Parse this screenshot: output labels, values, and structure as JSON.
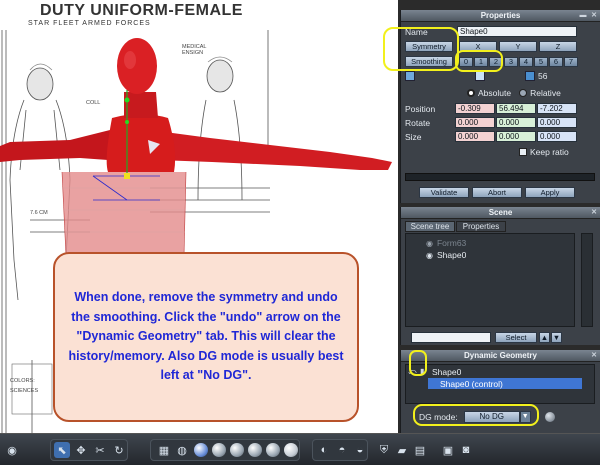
{
  "reference": {
    "title": "DUTY UNIFORM-FEMALE",
    "subtitle": "STAR FLEET ARMED FORCES",
    "labels": [
      "MEDICAL ENSIGN",
      "COLL",
      "7.6 CM",
      "COLORS:",
      "SCIENCES"
    ]
  },
  "callout": {
    "text": "When done, remove the symmetry and undo the smoothing. Click the \"undo\" arrow on the \"Dynamic Geometry\" tab. This will clear the history/memory. Also DG mode is usually best left at \"No DG\"."
  },
  "properties": {
    "title": "Properties",
    "name_label": "Name",
    "name_value": "Shape0",
    "symmetry_label": "Symmetry",
    "axes": [
      "X",
      "Y",
      "Z"
    ],
    "smoothing_label": "Smoothing",
    "smoothing_levels": [
      "0",
      "1",
      "2",
      "3",
      "4",
      "5",
      "6",
      "7"
    ],
    "polycount": "56",
    "absolute_label": "Absolute",
    "relative_label": "Relative",
    "position_label": "Position",
    "rotate_label": "Rotate",
    "size_label": "Size",
    "position": [
      "-0.309",
      "56.494",
      "-7.202"
    ],
    "rotate": [
      "0.000",
      "0.000",
      "0.000"
    ],
    "size": [
      "0.000",
      "0.000",
      "0.000"
    ],
    "keep_ratio_label": "Keep ratio",
    "validate_label": "Validate",
    "abort_label": "Abort",
    "apply_label": "Apply"
  },
  "scene": {
    "title": "Scene",
    "tabs": [
      "Scene tree",
      "Properties"
    ],
    "items": [
      "Form63",
      "Shape0"
    ],
    "select_label": "Select"
  },
  "dynamic_geometry": {
    "title": "Dynamic Geometry",
    "items": [
      "Shape0",
      "Shape0 (control)"
    ],
    "dg_mode_label": "DG mode:",
    "dg_mode_value": "No DG"
  },
  "colors": {
    "highlight": "#f2f01c",
    "figure": "#d61c1c",
    "callout_text": "#1f27d6",
    "callout_border": "#b8522a",
    "callout_bg": "#fbe1d4"
  }
}
